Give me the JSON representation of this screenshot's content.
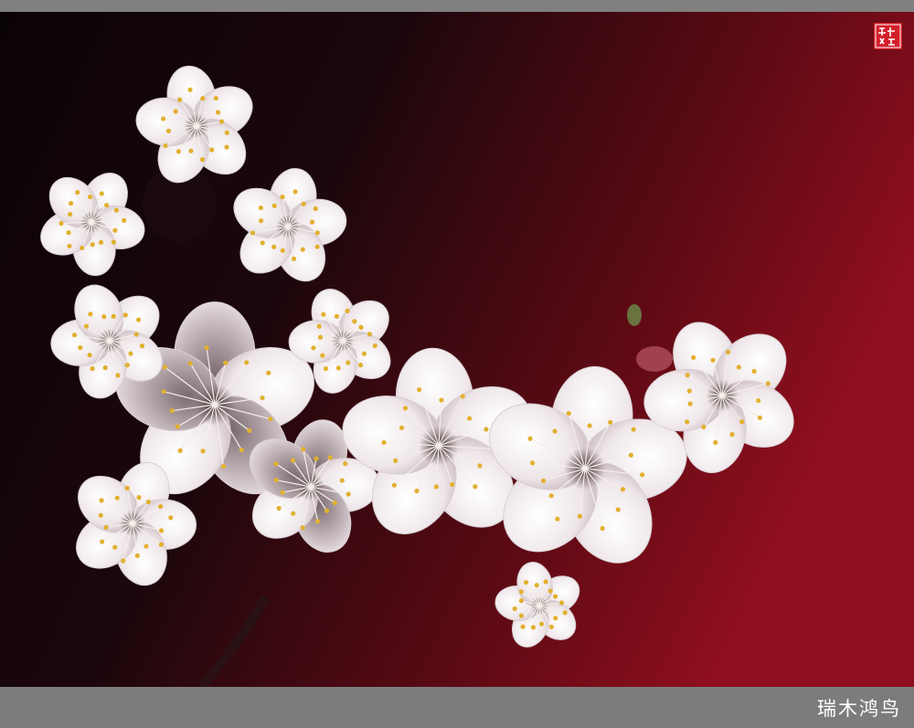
{
  "colors": {
    "frame": "#808080",
    "background_dark": "#12060a",
    "background_red": "#8a0d1c",
    "petal": "#f4eef0",
    "petal_shadow": "#8c7a80",
    "anther": "#e2b030",
    "seal_red": "#d4202a"
  },
  "signature": "瑞木鸿鸟",
  "seal": {
    "text": "瑞木鸿鸟",
    "icon": "seal-stamp-icon"
  }
}
